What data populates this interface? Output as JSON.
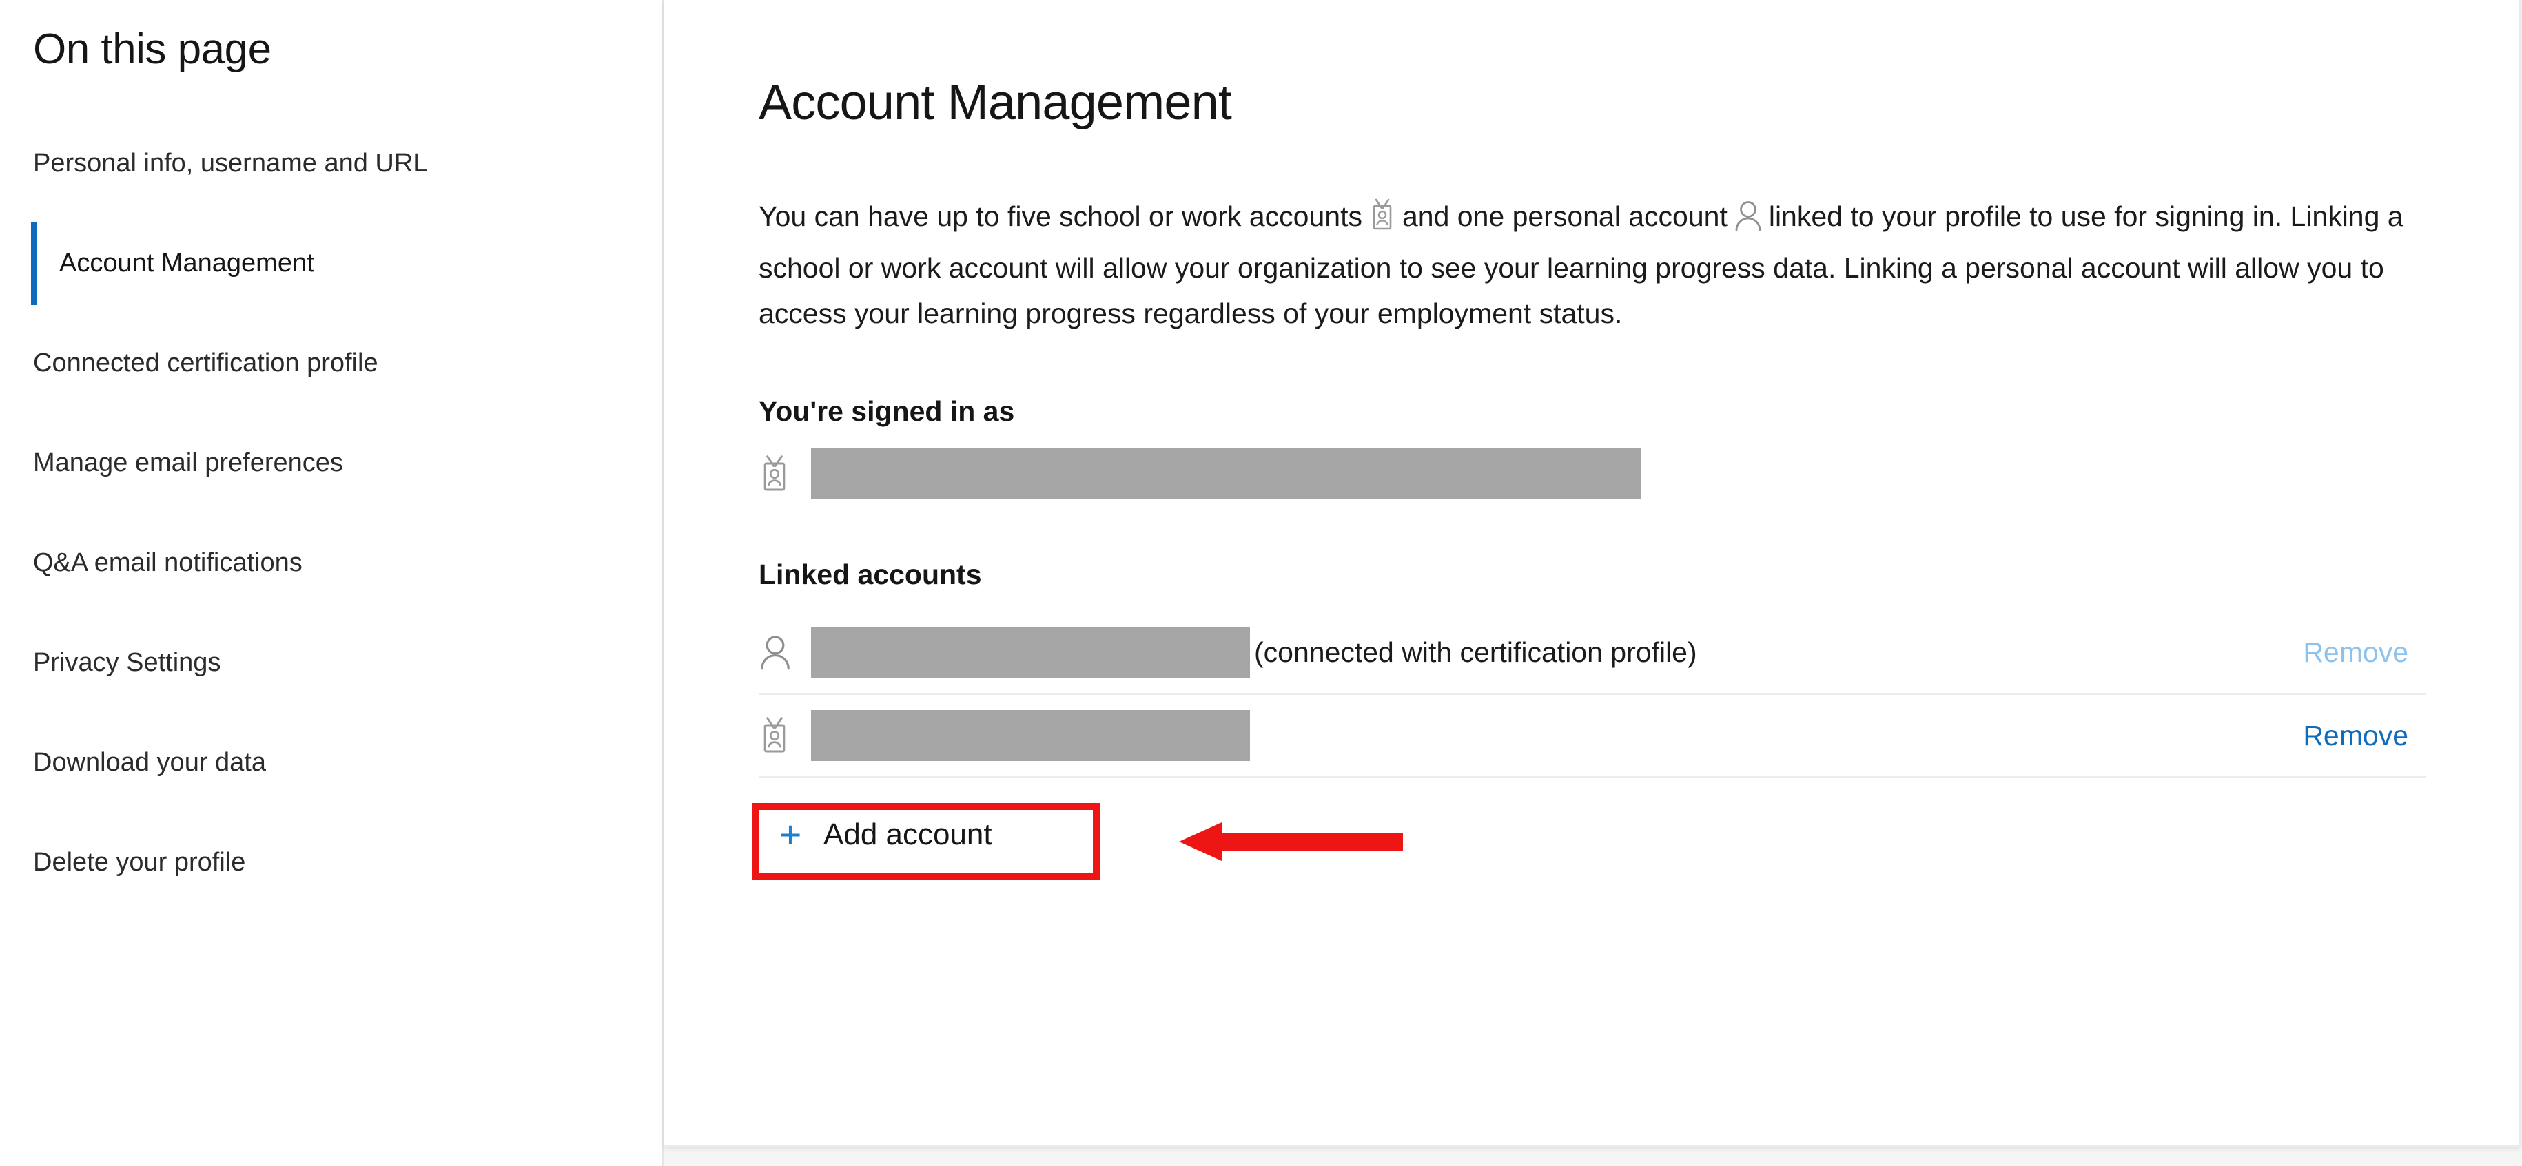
{
  "sidebar": {
    "title": "On this page",
    "items": [
      {
        "label": "Personal info, username and URL",
        "active": false
      },
      {
        "label": "Account Management",
        "active": true
      },
      {
        "label": "Connected certification profile",
        "active": false
      },
      {
        "label": "Manage email preferences",
        "active": false
      },
      {
        "label": "Q&A email notifications",
        "active": false
      },
      {
        "label": "Privacy Settings",
        "active": false
      },
      {
        "label": "Download your data",
        "active": false
      },
      {
        "label": "Delete your profile",
        "active": false
      }
    ]
  },
  "main": {
    "title": "Account Management",
    "intro": {
      "part1": "You can have up to five school or work accounts",
      "icon1": "badge-icon",
      "part2": "and one personal account",
      "icon2": "person-icon",
      "part3": "linked to your profile to use for signing in. Linking a school or work account will allow your organization to see your learning progress data. Linking a personal account will allow you to access your learning progress regardless of your employment status."
    },
    "signed_in": {
      "heading": "You're signed in as",
      "icon": "badge-icon",
      "value_redacted": true
    },
    "linked_accounts": {
      "heading": "Linked accounts",
      "rows": [
        {
          "icon": "person-icon",
          "value_redacted": true,
          "note": "(connected with certification profile)",
          "remove_label": "Remove",
          "remove_enabled": false
        },
        {
          "icon": "badge-icon",
          "value_redacted": true,
          "note": "",
          "remove_label": "Remove",
          "remove_enabled": true
        }
      ]
    },
    "add_account": {
      "icon": "plus-icon",
      "plus_glyph": "+",
      "label": "Add account"
    }
  },
  "annotation": {
    "highlight_color": "#ee1515",
    "arrow_color": "#ee1515",
    "arrow_direction": "left",
    "target": "add-account-button"
  },
  "colors": {
    "accent_blue": "#0f6cbd",
    "muted_blue": "#8cc2ee",
    "redaction_gray": "#a6a6a6",
    "divider_gray": "#ececec",
    "text_primary": "#161616"
  }
}
